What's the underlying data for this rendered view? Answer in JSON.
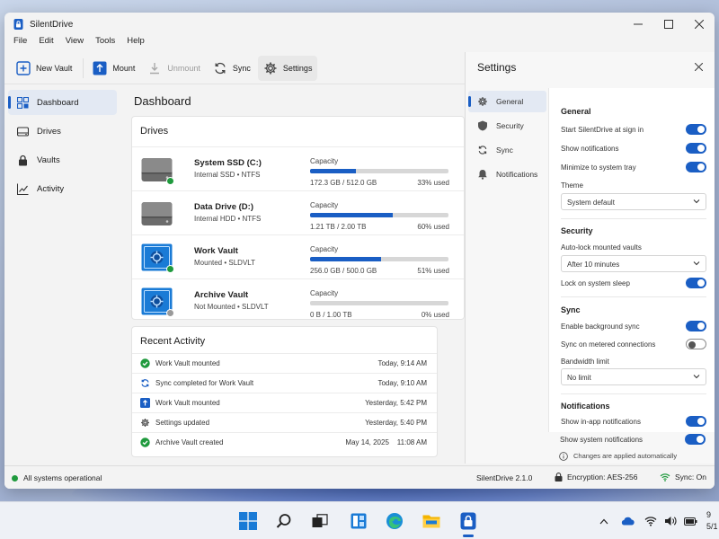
{
  "app": {
    "title": "SilentDrive"
  },
  "menu": [
    "File",
    "Edit",
    "View",
    "Tools",
    "Help"
  ],
  "toolbar": {
    "new_vault": "New Vault",
    "mount": "Mount",
    "unmount": "Unmount",
    "sync": "Sync",
    "settings": "Settings"
  },
  "sidebar": {
    "items": [
      {
        "label": "Dashboard",
        "icon": "dashboard-icon"
      },
      {
        "label": "Drives",
        "icon": "drive-icon"
      },
      {
        "label": "Vaults",
        "icon": "lock-icon"
      },
      {
        "label": "Activity",
        "icon": "chart-line-icon"
      }
    ]
  },
  "dashboard": {
    "title": "Dashboard",
    "drives_title": "Drives",
    "drives": [
      {
        "name": "System SSD (C:)",
        "sub": "Internal SSD • NTFS",
        "capacity_label": "Capacity",
        "used": "172.3 GB / 512.0 GB",
        "pct_label": "33% used",
        "pct": 33,
        "kind": "hdd",
        "status": "online"
      },
      {
        "name": "Data Drive (D:)",
        "sub": "Internal HDD • NTFS",
        "capacity_label": "Capacity",
        "used": "1.21 TB / 2.00 TB",
        "pct_label": "60% used",
        "pct": 60,
        "kind": "hdd",
        "status": "none"
      },
      {
        "name": "Work Vault",
        "sub": "Mounted • SLDVLT",
        "capacity_label": "Capacity",
        "used": "256.0 GB / 500.0 GB",
        "pct_label": "51% used",
        "pct": 51,
        "kind": "vault",
        "status": "online"
      },
      {
        "name": "Archive Vault",
        "sub": "Not Mounted • SLDVLT",
        "capacity_label": "Capacity",
        "used": "0 B / 1.00 TB",
        "pct_label": "0% used",
        "pct": 0,
        "kind": "vault",
        "status": "offline"
      }
    ],
    "activity_title": "Recent Activity",
    "activity": [
      {
        "text": "Work Vault mounted",
        "time": "Today, 9:14 AM",
        "icon": "check-circle-icon"
      },
      {
        "text": "Sync completed for Work Vault",
        "time": "Today, 9:10 AM",
        "icon": "sync-icon"
      },
      {
        "text": "Work Vault mounted",
        "time": "Yesterday, 5:42 PM",
        "icon": "mount-icon"
      },
      {
        "text": "Settings updated",
        "time": "Yesterday, 5:40 PM",
        "icon": "gear-icon"
      },
      {
        "text": "Archive Vault created",
        "time": "May 14, 2025    11:08 AM",
        "icon": "check-circle-icon"
      }
    ]
  },
  "settings": {
    "title": "Settings",
    "nav": [
      "General",
      "Security",
      "Sync",
      "Notifications"
    ],
    "general": {
      "heading": "General",
      "start_at_signin": "Start SilentDrive at sign in",
      "show_notifications": "Show notifications",
      "minimize_tray": "Minimize to system tray",
      "theme_label": "Theme",
      "theme_value": "System default"
    },
    "security": {
      "heading": "Security",
      "autolock_label": "Auto-lock mounted vaults",
      "autolock_value": "After 10 minutes",
      "lock_on_sleep": "Lock on system sleep"
    },
    "sync": {
      "heading": "Sync",
      "enable_bg": "Enable background sync",
      "metered": "Sync on metered connections",
      "bandwidth_label": "Bandwidth limit",
      "bandwidth_value": "No limit"
    },
    "notifications": {
      "heading": "Notifications",
      "in_app": "Show in-app notifications",
      "system": "Show system notifications"
    },
    "footer": "Changes are applied automatically"
  },
  "status": {
    "left": "All systems operational",
    "version": "SilentDrive 2.1.0",
    "encryption": "Encryption: AES-256",
    "sync": "Sync: On"
  },
  "taskbar": {
    "clock_time": "9",
    "clock_date": "5/1"
  },
  "colors": {
    "accent": "#1a5ec4",
    "online": "#1f9a3d",
    "offline": "#9a9a9a"
  }
}
